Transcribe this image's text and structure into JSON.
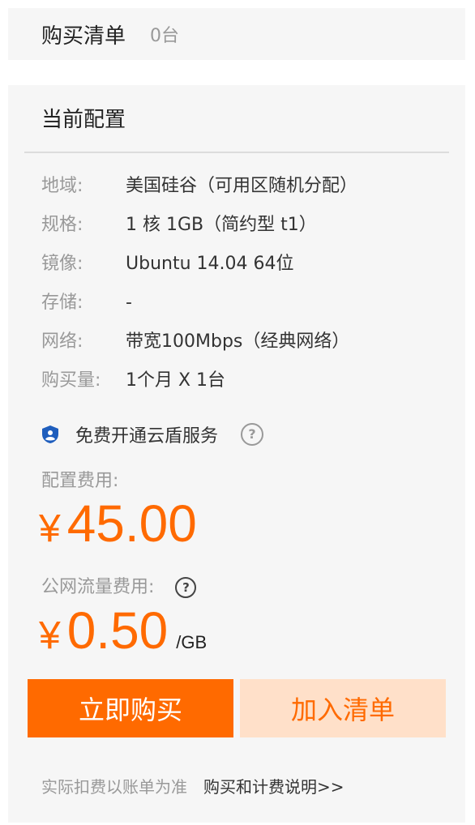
{
  "cart": {
    "title": "购买清单",
    "count": "0台"
  },
  "config": {
    "title": "当前配置",
    "specs": [
      {
        "label": "地域:",
        "value": "美国硅谷（可用区随机分配）"
      },
      {
        "label": "规格:",
        "value": "1 核 1GB（简约型 t1）"
      },
      {
        "label": "镜像:",
        "value": "Ubuntu 14.04 64位"
      },
      {
        "label": "存储:",
        "value": "-"
      },
      {
        "label": "网络:",
        "value": "带宽100Mbps（经典网络）"
      },
      {
        "label": "购买量:",
        "value": "1个月 X 1台"
      }
    ],
    "cloud_shield": {
      "label": "免费开通云盾服务",
      "icon": "shield-icon",
      "help_glyph": "?"
    },
    "config_fee": {
      "label": "配置费用:",
      "currency": "¥",
      "amount": "45.00"
    },
    "traffic_fee": {
      "label": "公网流量费用:",
      "help_glyph": "?",
      "currency": "¥",
      "amount": "0.50",
      "unit": "/GB"
    },
    "buttons": {
      "buy_now": "立即购买",
      "add_to_cart": "加入清单"
    },
    "footer": {
      "note": "实际扣费以账单为准",
      "link": "购买和计费说明>>"
    }
  },
  "colors": {
    "accent": "#ff6a00",
    "accent_light": "#ffe0c9",
    "shield": "#1f5ebd",
    "panel_bg": "#f6f6f6"
  }
}
